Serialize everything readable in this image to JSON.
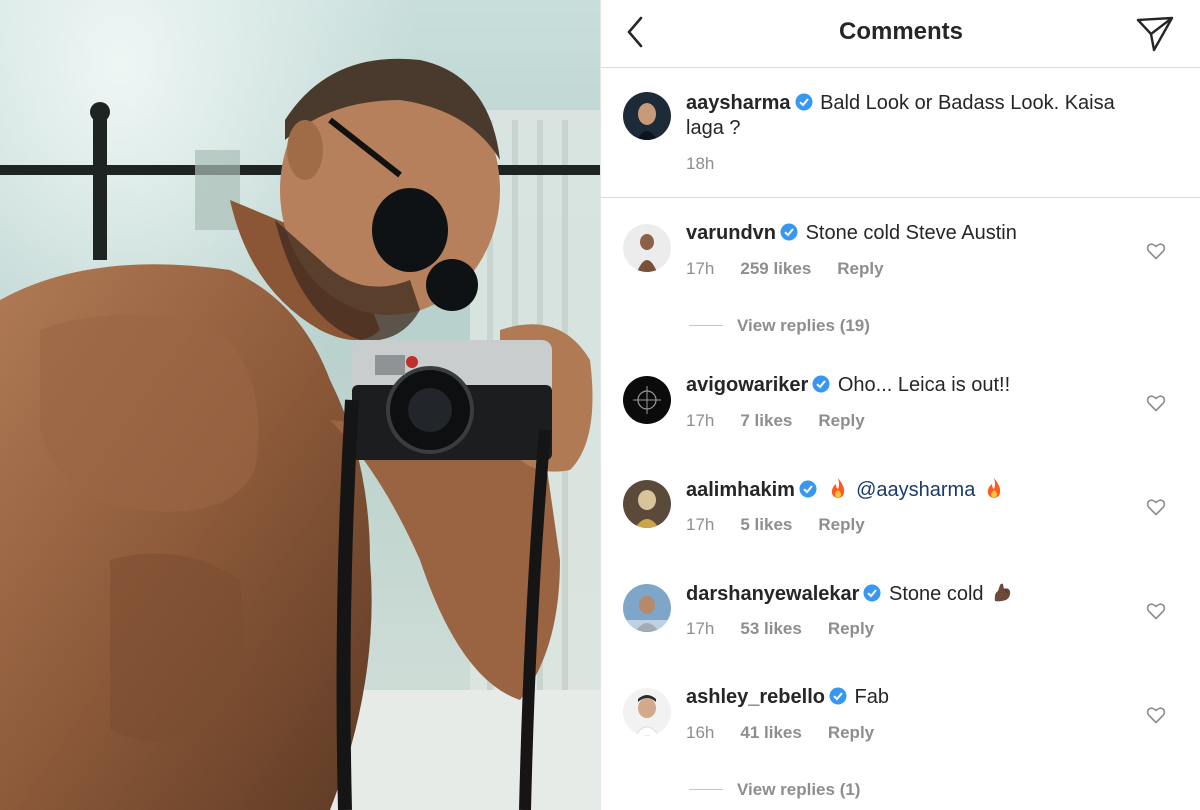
{
  "header": {
    "title": "Comments"
  },
  "caption": {
    "username": "aaysharma",
    "text": "Bald Look or Badass Look.  Kaisa",
    "text_line2": "laga ?",
    "time": "18h"
  },
  "comments": [
    {
      "username": "varundvn",
      "text": "Stone cold Steve Austin",
      "time": "17h",
      "likes": "259 likes",
      "reply": "Reply"
    },
    {
      "username": "avigowariker",
      "text": "Oho... Leica is out!!",
      "time": "17h",
      "likes": "7 likes",
      "reply": "Reply"
    },
    {
      "username": "aalimhakim",
      "mention": "@aaysharma",
      "time": "17h",
      "likes": "5 likes",
      "reply": "Reply"
    },
    {
      "username": "darshanyewalekar",
      "text": "Stone cold",
      "time": "17h",
      "likes": "53 likes",
      "reply": "Reply"
    },
    {
      "username": "ashley_rebello",
      "text": "Fab",
      "time": "16h",
      "likes": "41 likes",
      "reply": "Reply"
    }
  ],
  "view_replies": [
    "View replies (19)",
    "View replies (1)"
  ],
  "icons": {
    "back": "chevron-left-icon",
    "send": "paper-plane-icon",
    "verified": "verified-badge-icon",
    "like": "heart-outline-icon",
    "fire": "fire-emoji",
    "flex": "flexed-biceps-emoji"
  },
  "colors": {
    "verified": "#3897f0",
    "mention": "#1a3a6e",
    "muted": "#8e8e8e",
    "divider": "#dbdbdb"
  }
}
